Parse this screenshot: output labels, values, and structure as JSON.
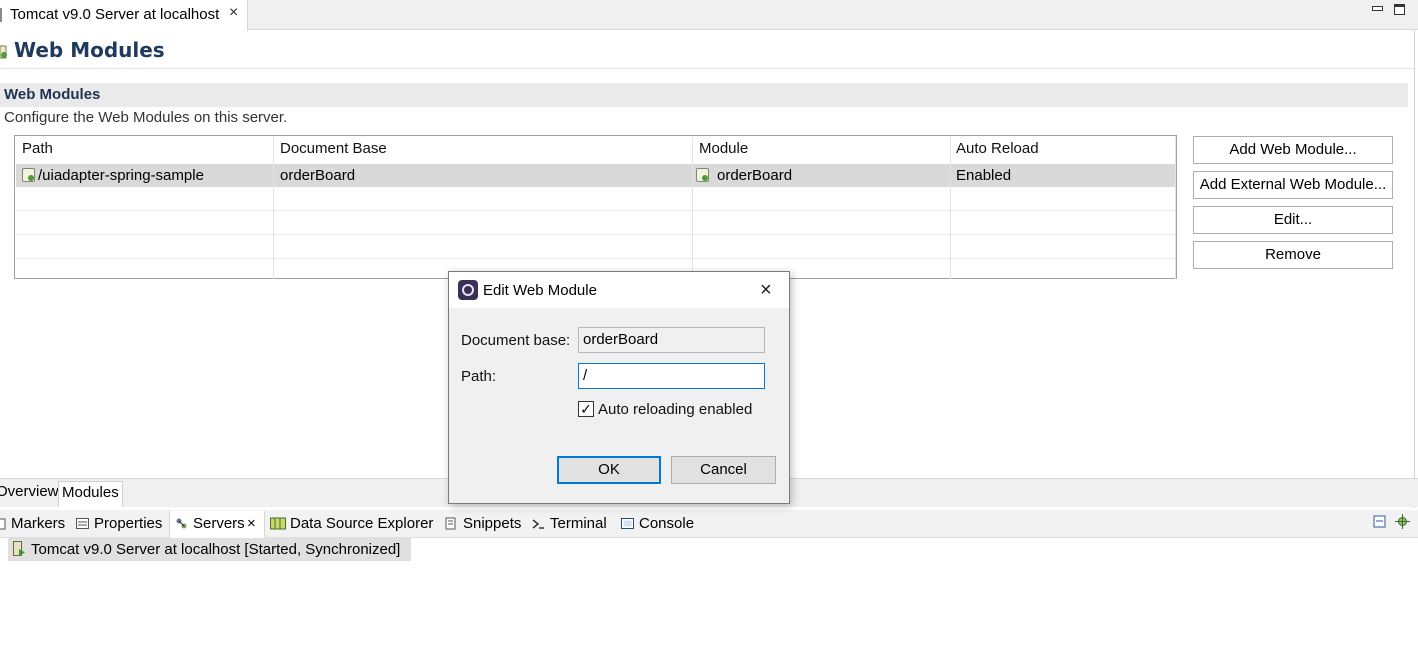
{
  "editor_tab": {
    "title": "Tomcat v9.0 Server at localhost",
    "close": "×"
  },
  "page": {
    "title": "Web Modules",
    "section_title": "Web Modules",
    "section_description": "Configure the Web Modules on this server."
  },
  "table": {
    "columns": [
      "Path",
      "Document Base",
      "Module",
      "Auto Reload"
    ],
    "rows": [
      {
        "path": "/uiadapter-spring-sample",
        "document_base": "orderBoard",
        "module": "orderBoard",
        "auto_reload": "Enabled"
      }
    ]
  },
  "buttons": {
    "add_web_module": "Add Web Module...",
    "add_external_web_module": "Add External Web Module...",
    "edit": "Edit...",
    "remove": "Remove"
  },
  "editor_bottom_tabs": [
    "Overview",
    "Modules"
  ],
  "views": {
    "tabs": [
      "Markers",
      "Properties",
      "Servers",
      "Data Source Explorer",
      "Snippets",
      "Terminal",
      "Console"
    ],
    "servers_close": "×",
    "server_entry": "Tomcat v9.0 Server at localhost  [Started, Synchronized]"
  },
  "dialog": {
    "title": "Edit Web Module",
    "close": "×",
    "document_base_label": "Document base:",
    "document_base_value": "orderBoard",
    "path_label": "Path:",
    "path_value": "/",
    "auto_reload_label": "Auto reloading enabled",
    "auto_reload_checked": "✓",
    "ok": "OK",
    "cancel": "Cancel"
  }
}
